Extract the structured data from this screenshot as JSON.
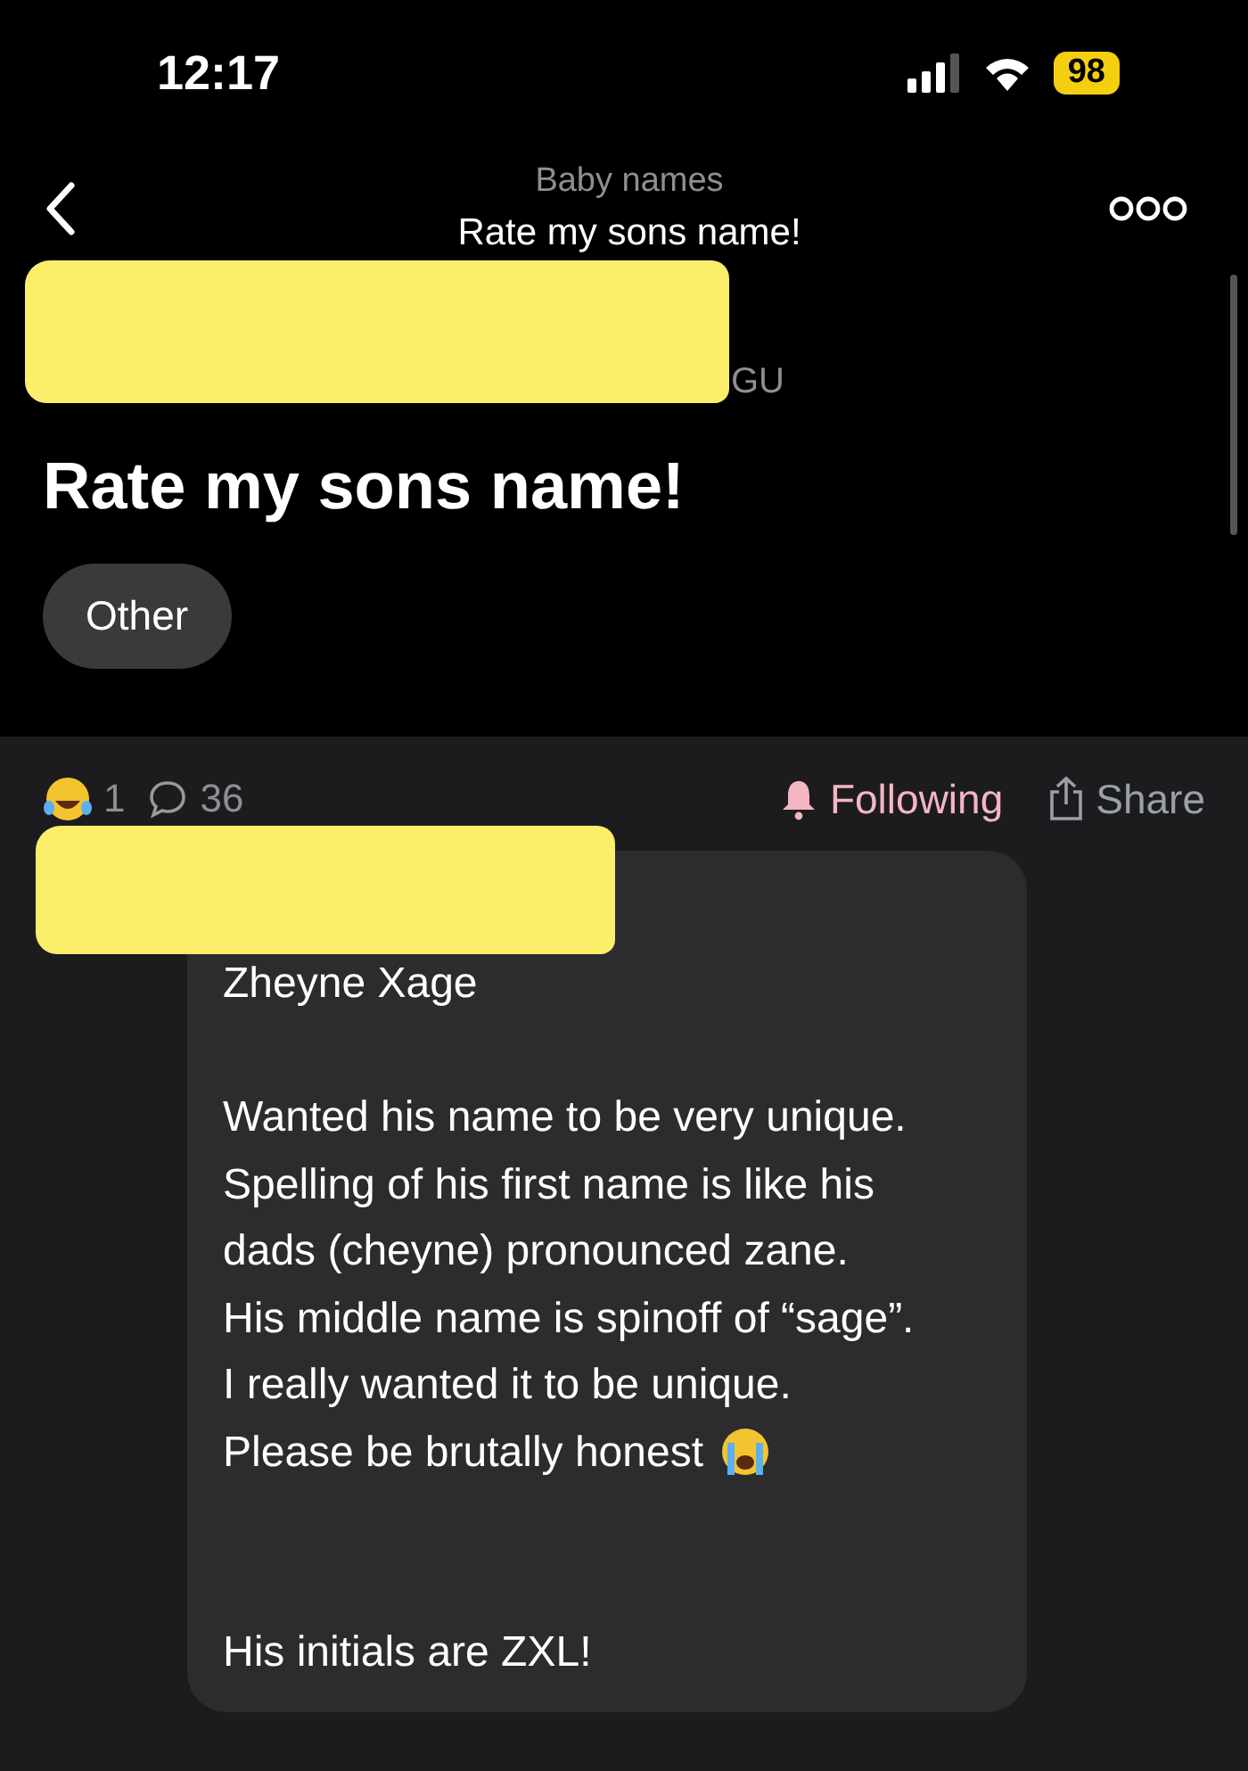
{
  "status_bar": {
    "time": "12:17",
    "battery": "98"
  },
  "header": {
    "community": "Baby names",
    "title": "Rate my sons name!"
  },
  "author": {
    "visible_text": "GU"
  },
  "post": {
    "title": "Rate my sons name!",
    "tag": "Other"
  },
  "stats": {
    "reactions": "1",
    "comments": "36"
  },
  "actions": {
    "following": {
      "label": "Following",
      "on": true
    },
    "share": "Share"
  },
  "message": {
    "paragraphs": [
      {
        "lines": [
          "Zheyne Xage"
        ],
        "emoji": false
      },
      {
        "lines": [
          "Wanted his name to be very unique.",
          "Spelling of his first name is like his",
          "dads (cheyne) pronounced zane.",
          "His middle name is spinoff of “sage”.",
          "I really wanted it to be unique.",
          "Please be brutally honest"
        ],
        "emoji": true
      },
      {
        "lines": [
          "His initials are ZXL!"
        ],
        "emoji": false
      }
    ]
  }
}
